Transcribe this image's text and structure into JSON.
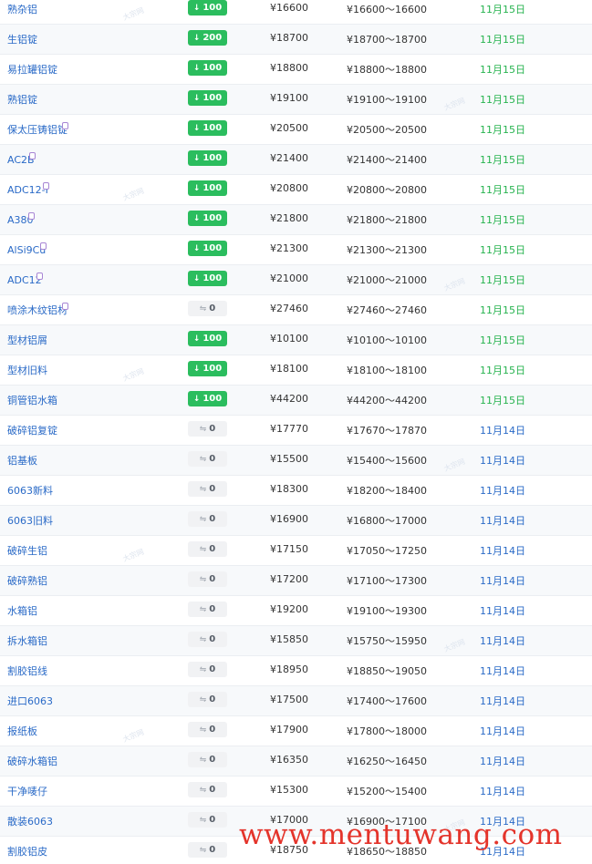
{
  "currency_symbol": "¥",
  "range_separator": "～",
  "colors": {
    "link": "#2a6ac7",
    "up_badge": "#2bbd5e",
    "flat_badge": "#f1f2f4",
    "date_recent": "#27b34f",
    "watermark": "#e4342b"
  },
  "icons": {
    "down_arrow": "↓",
    "flat_arrow": "⇋"
  },
  "watermark_text": "大宗网",
  "footer_watermark": "www.mentuwang.com",
  "rows": [
    {
      "name": "熟杂铝",
      "change": "100",
      "flat": false,
      "price": "16600",
      "low": "16600",
      "high": "16600",
      "date": "11月15日",
      "recent": true,
      "icon": false
    },
    {
      "name": "生铝锭",
      "change": "200",
      "flat": false,
      "price": "18700",
      "low": "18700",
      "high": "18700",
      "date": "11月15日",
      "recent": true,
      "icon": false
    },
    {
      "name": "易拉罐铝锭",
      "change": "100",
      "flat": false,
      "price": "18800",
      "low": "18800",
      "high": "18800",
      "date": "11月15日",
      "recent": true,
      "icon": false
    },
    {
      "name": "熟铝锭",
      "change": "100",
      "flat": false,
      "price": "19100",
      "low": "19100",
      "high": "19100",
      "date": "11月15日",
      "recent": true,
      "icon": false
    },
    {
      "name": "保太压铸铝锭",
      "change": "100",
      "flat": false,
      "price": "20500",
      "low": "20500",
      "high": "20500",
      "date": "11月15日",
      "recent": true,
      "icon": true
    },
    {
      "name": "AC2B",
      "change": "100",
      "flat": false,
      "price": "21400",
      "low": "21400",
      "high": "21400",
      "date": "11月15日",
      "recent": true,
      "icon": true
    },
    {
      "name": "ADC12-I",
      "change": "100",
      "flat": false,
      "price": "20800",
      "low": "20800",
      "high": "20800",
      "date": "11月15日",
      "recent": true,
      "icon": true
    },
    {
      "name": "A380",
      "change": "100",
      "flat": false,
      "price": "21800",
      "low": "21800",
      "high": "21800",
      "date": "11月15日",
      "recent": true,
      "icon": true
    },
    {
      "name": "AlSi9Cu",
      "change": "100",
      "flat": false,
      "price": "21300",
      "low": "21300",
      "high": "21300",
      "date": "11月15日",
      "recent": true,
      "icon": true
    },
    {
      "name": "ADC12",
      "change": "100",
      "flat": false,
      "price": "21000",
      "low": "21000",
      "high": "21000",
      "date": "11月15日",
      "recent": true,
      "icon": true
    },
    {
      "name": "喷涂木纹铝材",
      "change": "0",
      "flat": true,
      "price": "27460",
      "low": "27460",
      "high": "27460",
      "date": "11月15日",
      "recent": true,
      "icon": true
    },
    {
      "name": "型材铝屑",
      "change": "100",
      "flat": false,
      "price": "10100",
      "low": "10100",
      "high": "10100",
      "date": "11月15日",
      "recent": true,
      "icon": false
    },
    {
      "name": "型材旧料",
      "change": "100",
      "flat": false,
      "price": "18100",
      "low": "18100",
      "high": "18100",
      "date": "11月15日",
      "recent": true,
      "icon": false
    },
    {
      "name": "铜管铝水箱",
      "change": "100",
      "flat": false,
      "price": "44200",
      "low": "44200",
      "high": "44200",
      "date": "11月15日",
      "recent": true,
      "icon": false
    },
    {
      "name": "破碎铝复锭",
      "change": "0",
      "flat": true,
      "price": "17770",
      "low": "17670",
      "high": "17870",
      "date": "11月14日",
      "recent": false,
      "icon": false
    },
    {
      "name": "铝基板",
      "change": "0",
      "flat": true,
      "price": "15500",
      "low": "15400",
      "high": "15600",
      "date": "11月14日",
      "recent": false,
      "icon": false
    },
    {
      "name": "6063新料",
      "change": "0",
      "flat": true,
      "price": "18300",
      "low": "18200",
      "high": "18400",
      "date": "11月14日",
      "recent": false,
      "icon": false
    },
    {
      "name": "6063旧料",
      "change": "0",
      "flat": true,
      "price": "16900",
      "low": "16800",
      "high": "17000",
      "date": "11月14日",
      "recent": false,
      "icon": false
    },
    {
      "name": "破碎生铝",
      "change": "0",
      "flat": true,
      "price": "17150",
      "low": "17050",
      "high": "17250",
      "date": "11月14日",
      "recent": false,
      "icon": false
    },
    {
      "name": "破碎熟铝",
      "change": "0",
      "flat": true,
      "price": "17200",
      "low": "17100",
      "high": "17300",
      "date": "11月14日",
      "recent": false,
      "icon": false
    },
    {
      "name": "水箱铝",
      "change": "0",
      "flat": true,
      "price": "19200",
      "low": "19100",
      "high": "19300",
      "date": "11月14日",
      "recent": false,
      "icon": false
    },
    {
      "name": "拆水箱铝",
      "change": "0",
      "flat": true,
      "price": "15850",
      "low": "15750",
      "high": "15950",
      "date": "11月14日",
      "recent": false,
      "icon": false
    },
    {
      "name": "割胶铝线",
      "change": "0",
      "flat": true,
      "price": "18950",
      "low": "18850",
      "high": "19050",
      "date": "11月14日",
      "recent": false,
      "icon": false
    },
    {
      "name": "进口6063",
      "change": "0",
      "flat": true,
      "price": "17500",
      "low": "17400",
      "high": "17600",
      "date": "11月14日",
      "recent": false,
      "icon": false
    },
    {
      "name": "报纸板",
      "change": "0",
      "flat": true,
      "price": "17900",
      "low": "17800",
      "high": "18000",
      "date": "11月14日",
      "recent": false,
      "icon": false
    },
    {
      "name": "破碎水箱铝",
      "change": "0",
      "flat": true,
      "price": "16350",
      "low": "16250",
      "high": "16450",
      "date": "11月14日",
      "recent": false,
      "icon": false
    },
    {
      "name": "干净唛仔",
      "change": "0",
      "flat": true,
      "price": "15300",
      "low": "15200",
      "high": "15400",
      "date": "11月14日",
      "recent": false,
      "icon": false
    },
    {
      "name": "散装6063",
      "change": "0",
      "flat": true,
      "price": "17000",
      "low": "16900",
      "high": "17100",
      "date": "11月14日",
      "recent": false,
      "icon": false
    },
    {
      "name": "割胶铝皮",
      "change": "0",
      "flat": true,
      "price": "18750",
      "low": "18650",
      "high": "18850",
      "date": "11月14日",
      "recent": false,
      "icon": false
    }
  ]
}
